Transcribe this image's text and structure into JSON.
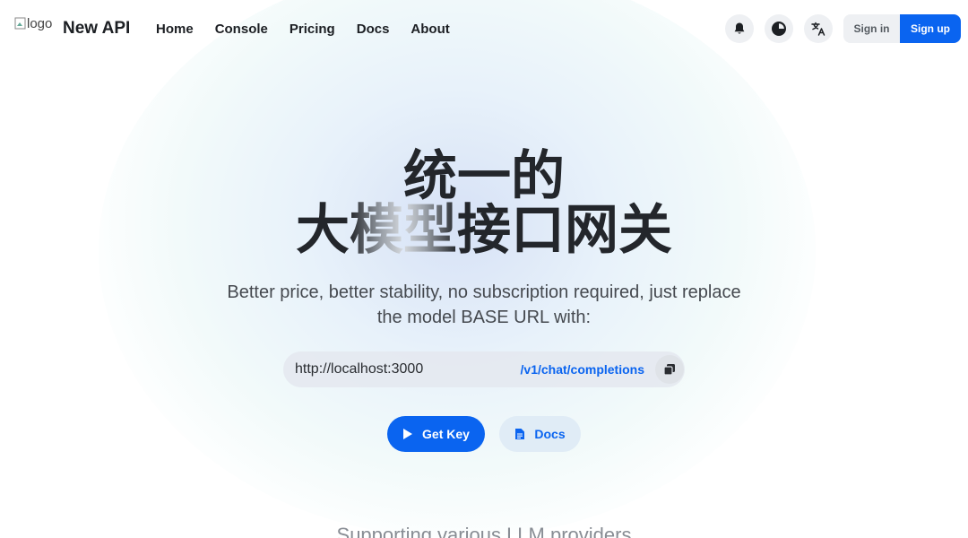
{
  "header": {
    "logo_alt": "logo",
    "brand": "New API",
    "nav": [
      {
        "label": "Home"
      },
      {
        "label": "Console"
      },
      {
        "label": "Pricing"
      },
      {
        "label": "Docs"
      },
      {
        "label": "About"
      }
    ],
    "icons": [
      "bell-icon",
      "moon-icon",
      "translate-icon"
    ],
    "sign_in": "Sign in",
    "sign_up": "Sign up"
  },
  "hero": {
    "title_line1": "统一的",
    "title_line2_a": "大",
    "title_line2_grad": "模型",
    "title_line2_b": "接口网关",
    "subtitle": "Better price, better stability, no subscription required, just replace the model BASE URL with:",
    "url_base": "http://localhost:3000",
    "url_path": "/v1/chat/completions",
    "get_key": "Get Key",
    "docs": "Docs"
  },
  "providers_heading": "Supporting various LLM providers",
  "colors": {
    "accent": "#0a64f0",
    "text": "#1c1f23",
    "button_bg": "#eef0f3"
  }
}
